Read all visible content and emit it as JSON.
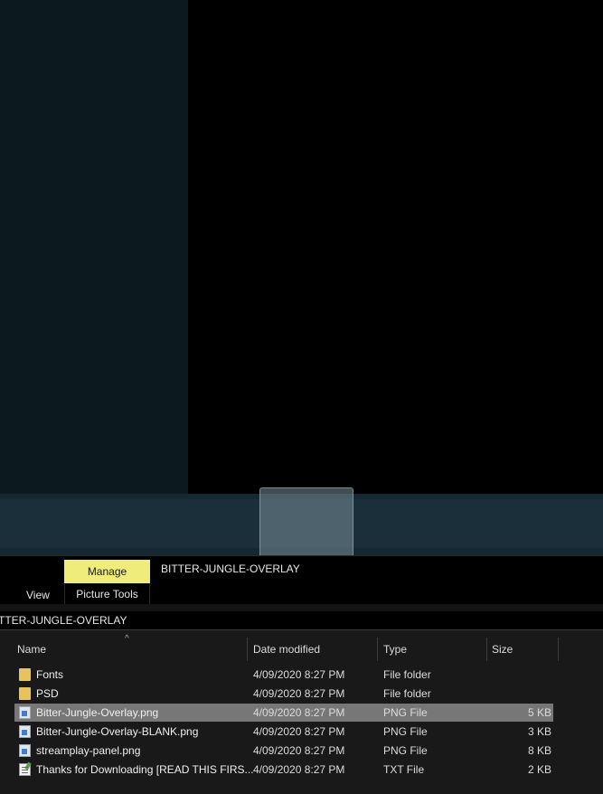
{
  "ribbon": {
    "manage_label": "Manage",
    "title": "BITTER-JUNGLE-OVERLAY",
    "view_label": "View",
    "picture_tools_label": "Picture Tools",
    "manage_color": "#f0ec7a"
  },
  "breadcrumb": {
    "path": "TTER-JUNGLE-OVERLAY"
  },
  "columns": {
    "name": "Name",
    "date": "Date modified",
    "type": "Type",
    "size": "Size"
  },
  "files": [
    {
      "name": "Fonts",
      "date": "4/09/2020 8:27 PM",
      "type": "File folder",
      "size": "",
      "icon": "folder-icon"
    },
    {
      "name": "PSD",
      "date": "4/09/2020 8:27 PM",
      "type": "File folder",
      "size": "",
      "icon": "folder-icon"
    },
    {
      "name": "Bitter-Jungle-Overlay.png",
      "date": "4/09/2020 8:27 PM",
      "type": "PNG File",
      "size": "5 KB",
      "icon": "png-file-icon",
      "selected": true
    },
    {
      "name": "Bitter-Jungle-Overlay-BLANK.png",
      "date": "4/09/2020 8:27 PM",
      "type": "PNG File",
      "size": "3 KB",
      "icon": "png-file-icon"
    },
    {
      "name": "streamplay-panel.png",
      "date": "4/09/2020 8:27 PM",
      "type": "PNG File",
      "size": "8 KB",
      "icon": "png-file-icon"
    },
    {
      "name": "Thanks for Downloading [READ THIS FIRS...",
      "date": "4/09/2020 8:27 PM",
      "type": "TXT File",
      "size": "2 KB",
      "icon": "txt-file-icon"
    }
  ]
}
